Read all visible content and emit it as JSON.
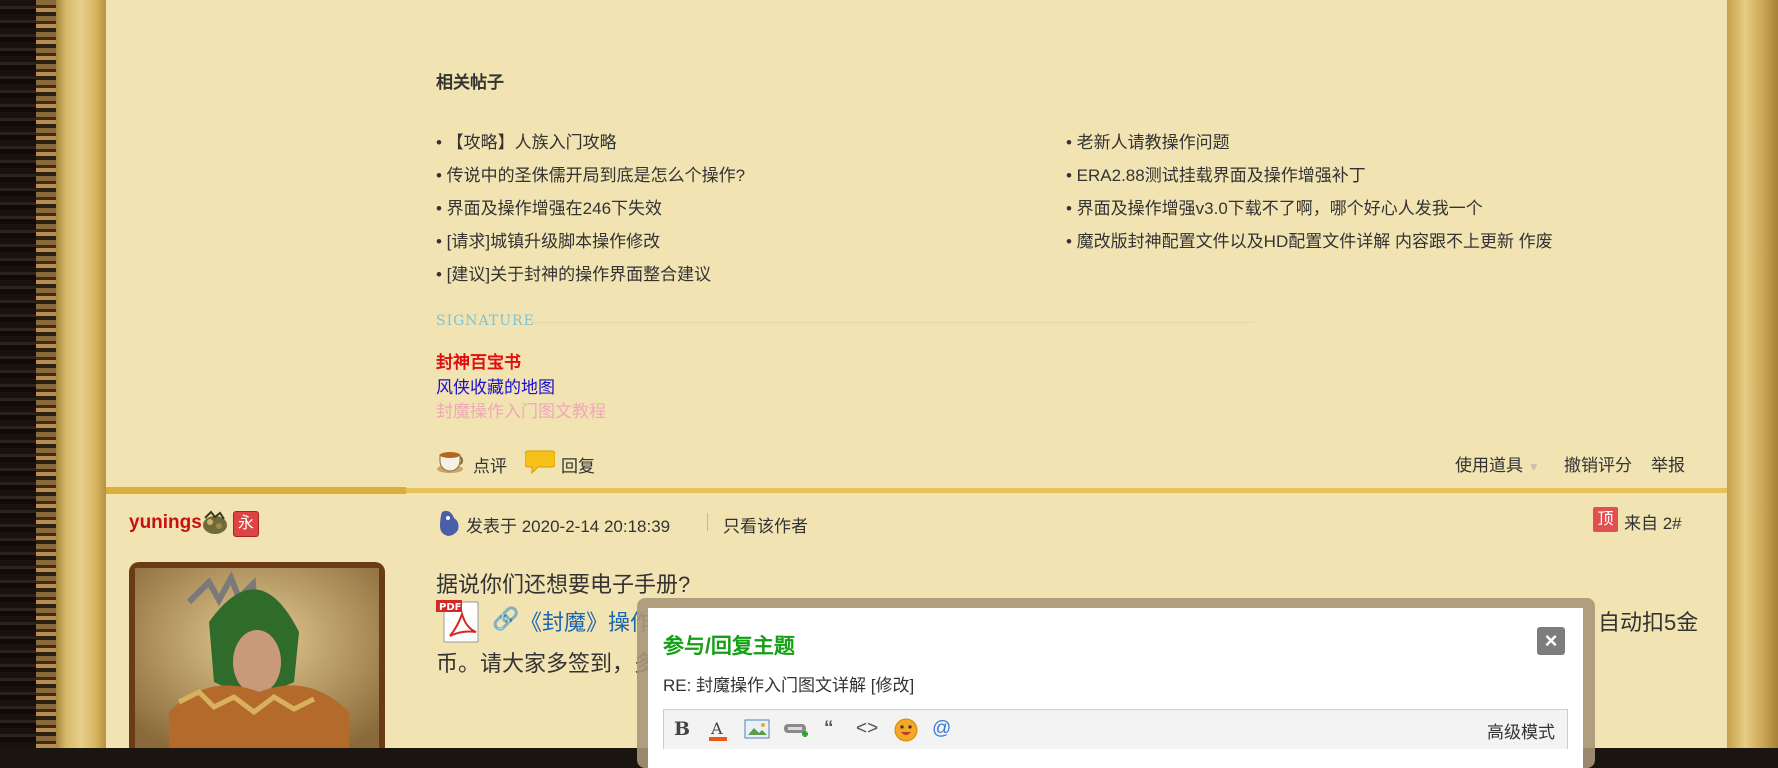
{
  "related": {
    "title": "相关帖子",
    "left": [
      "• 【攻略】人族入门攻略",
      "• 传说中的圣侏儒开局到底是怎么个操作?",
      "• 界面及操作增强在246下失效",
      "• [请求]城镇升级脚本操作修改",
      "• [建议]关于封神的操作界面整合建议"
    ],
    "right": [
      "• 老新人请教操作问题",
      "• ERA2.88测试挂载界面及操作增强补丁",
      "• 界面及操作增强v3.0下载不了啊，哪个好心人发我一个",
      "• 魔改版封神配置文件以及HD配置文件详解 内容跟不上更新 作废"
    ]
  },
  "signature": {
    "label": "SIGNATURE",
    "lines": [
      "封神百宝书",
      "风侠收藏的地图",
      "封魔操作入门图文教程"
    ]
  },
  "actions": {
    "comment": "点评",
    "reply": "回复",
    "use_item": "使用道具",
    "revoke_rating": "撤销评分",
    "report": "举报"
  },
  "post2": {
    "username": "yunings",
    "badge": "永",
    "posted_at": "发表于 2020-2-14 20:18:39",
    "only_author": "只看该作者",
    "top_badge": "顶",
    "floor": "来自 2#",
    "text1": "据说你们还想要电子手册?",
    "attachment": "《封魔》操作",
    "text2_tail": "自动扣5金",
    "text3": "币。请大家多签到，多"
  },
  "dialog": {
    "title": "参与/回复主题",
    "close": "×",
    "subject": "RE: 封魔操作入门图文详解 [修改]",
    "advanced": "高级模式"
  },
  "colors": {
    "page_bg": "#f2e3b3",
    "username": "#c8100f",
    "dialog_title": "#13a013"
  }
}
